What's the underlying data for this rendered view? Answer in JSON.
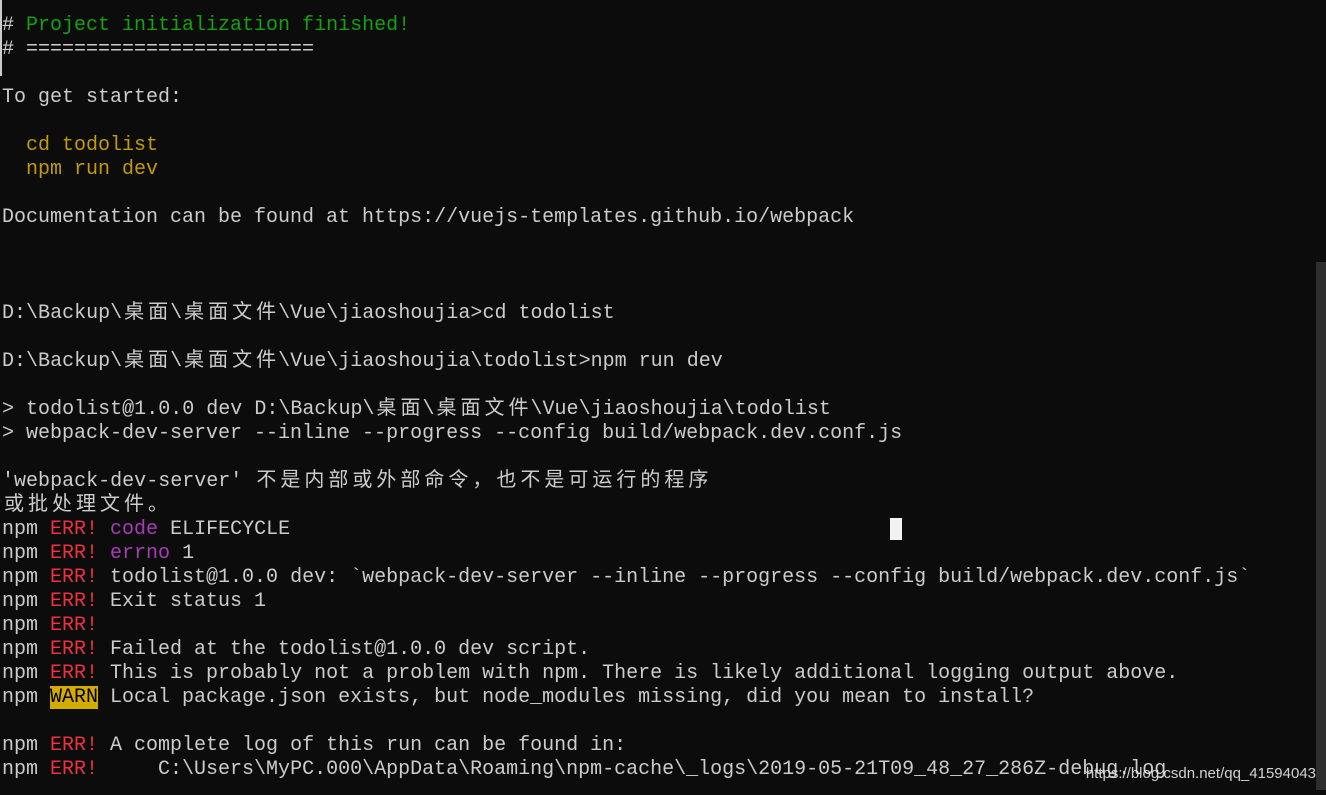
{
  "terminal": {
    "lines": [
      [
        {
          "t": "# "
        },
        {
          "t": "Project initialization finished!",
          "c": "green"
        }
      ],
      [
        {
          "t": "# ========================"
        }
      ],
      [],
      [
        {
          "t": "To get started:"
        }
      ],
      [],
      [
        {
          "t": "  cd todolist",
          "c": "yellow"
        }
      ],
      [
        {
          "t": "  npm run dev",
          "c": "yellow"
        }
      ],
      [],
      [
        {
          "t": "Documentation can be found at https://vuejs-templates.github.io/webpack"
        }
      ],
      [],
      [],
      [],
      [
        {
          "t": "D:\\Backup\\桌面\\桌面文件\\Vue\\jiaoshoujia>cd todolist"
        }
      ],
      [],
      [
        {
          "t": "D:\\Backup\\桌面\\桌面文件\\Vue\\jiaoshoujia\\todolist>npm run dev"
        }
      ],
      [],
      [
        {
          "t": "> todolist@1.0.0 dev D:\\Backup\\桌面\\桌面文件\\Vue\\jiaoshoujia\\todolist"
        }
      ],
      [
        {
          "t": "> webpack-dev-server --inline --progress --config build/webpack.dev.conf.js"
        }
      ],
      [],
      [
        {
          "t": "'webpack-dev-server' 不是内部或外部命令，也不是可运行的程序"
        }
      ],
      [
        {
          "t": "或批处理文件。"
        }
      ],
      [
        {
          "t": "npm "
        },
        {
          "t": "ERR!",
          "c": "red"
        },
        {
          "t": " "
        },
        {
          "t": "code",
          "c": "purple"
        },
        {
          "t": " ELIFECYCLE"
        }
      ],
      [
        {
          "t": "npm "
        },
        {
          "t": "ERR!",
          "c": "red"
        },
        {
          "t": " "
        },
        {
          "t": "errno",
          "c": "purple"
        },
        {
          "t": " 1"
        }
      ],
      [
        {
          "t": "npm "
        },
        {
          "t": "ERR!",
          "c": "red"
        },
        {
          "t": " todolist@1.0.0 dev: `webpack-dev-server --inline --progress --config build/webpack.dev.conf.js`"
        }
      ],
      [
        {
          "t": "npm "
        },
        {
          "t": "ERR!",
          "c": "red"
        },
        {
          "t": " Exit status 1"
        }
      ],
      [
        {
          "t": "npm "
        },
        {
          "t": "ERR!",
          "c": "red"
        }
      ],
      [
        {
          "t": "npm "
        },
        {
          "t": "ERR!",
          "c": "red"
        },
        {
          "t": " Failed at the todolist@1.0.0 dev script."
        }
      ],
      [
        {
          "t": "npm "
        },
        {
          "t": "ERR!",
          "c": "red"
        },
        {
          "t": " This is probably not a problem with npm. There is likely additional logging output above."
        }
      ],
      [
        {
          "t": "npm "
        },
        {
          "t": "WARN",
          "c": "warn"
        },
        {
          "t": " Local package.json exists, but node_modules missing, did you mean to install?"
        }
      ],
      [],
      [
        {
          "t": "npm "
        },
        {
          "t": "ERR!",
          "c": "red"
        },
        {
          "t": " A complete log of this run can be found in:"
        }
      ],
      [
        {
          "t": "npm "
        },
        {
          "t": "ERR!",
          "c": "red"
        },
        {
          "t": "     C:\\Users\\MyPC.000\\AppData\\Roaming\\npm-cache\\_logs\\2019-05-21T09_48_27_286Z-debug.log"
        }
      ]
    ]
  },
  "colors": {
    "background": "#0c0c0c",
    "text": "#cccccc",
    "green": "#13a10e",
    "yellow": "#c19c00",
    "red": "#c50f1f",
    "purple": "#881798"
  },
  "watermark": "https://blog.csdn.net/qq_41594043"
}
